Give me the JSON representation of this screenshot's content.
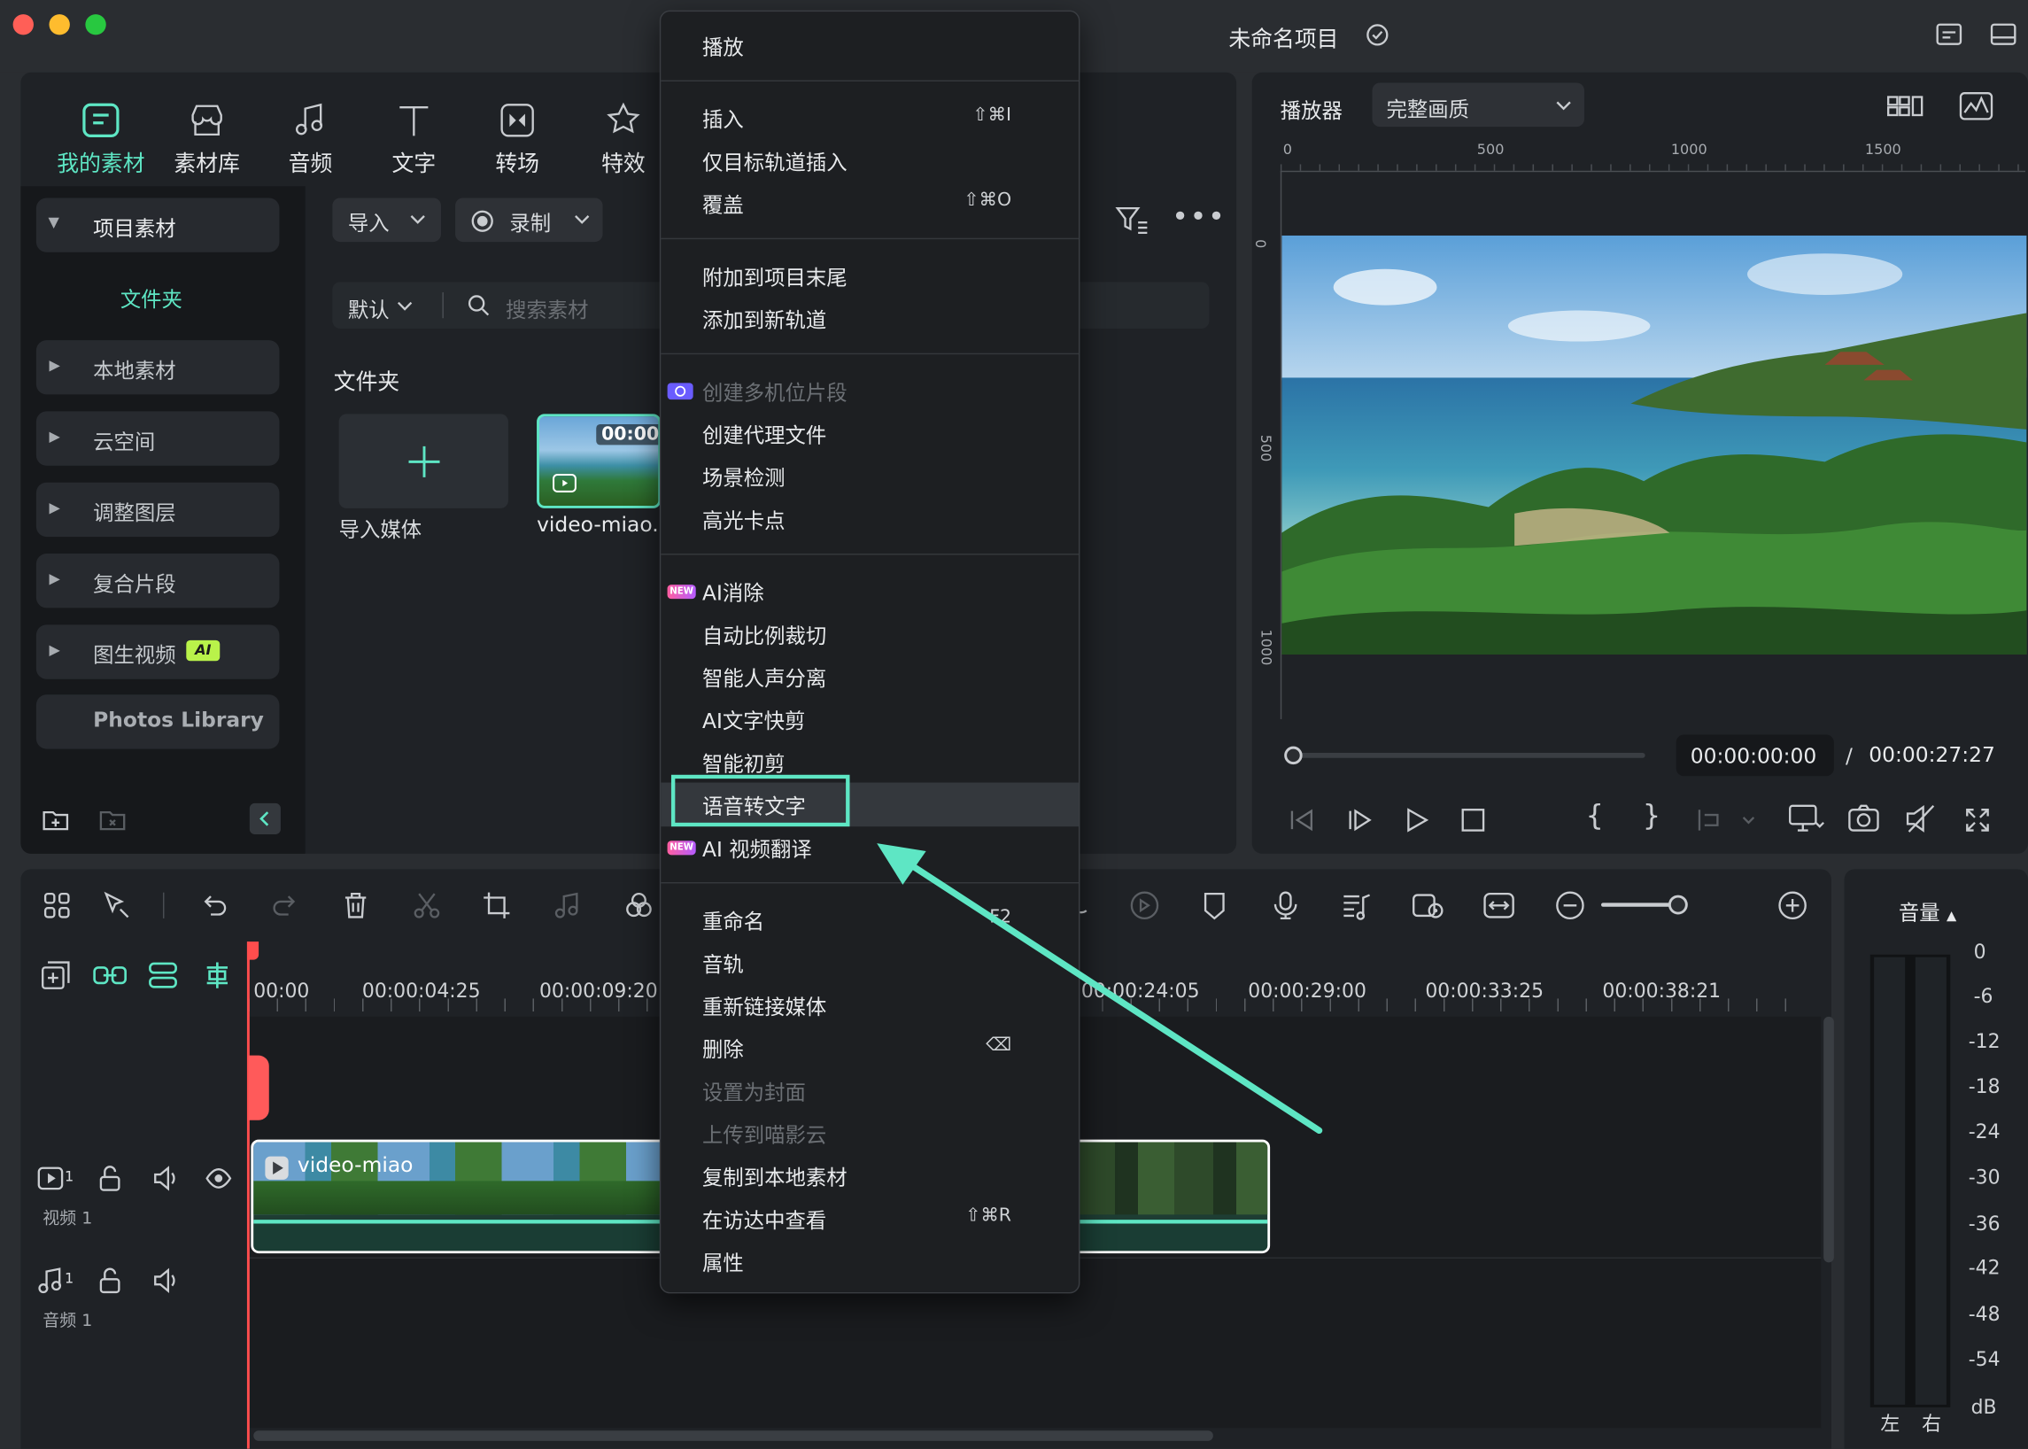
{
  "window": {
    "title": "未命名项目"
  },
  "tabs": [
    {
      "label": "我的素材",
      "icon": "my-media-icon",
      "active": true
    },
    {
      "label": "素材库",
      "icon": "stock-icon"
    },
    {
      "label": "音频",
      "icon": "music-icon"
    },
    {
      "label": "文字",
      "icon": "text-icon"
    },
    {
      "label": "转场",
      "icon": "transition-icon"
    },
    {
      "label": "特效",
      "icon": "effects-icon"
    }
  ],
  "sidebar": {
    "project_media": "项目素材",
    "folder": "文件夹",
    "items": [
      "本地素材",
      "云空间",
      "调整图层",
      "复合片段",
      "图生视频"
    ],
    "ai_badge": "AI",
    "photos": "Photos Library"
  },
  "media": {
    "import_label": "导入",
    "record_label": "录制",
    "sort_label": "默认",
    "search_placeholder": "搜索素材",
    "folder_title": "文件夹",
    "import_media_label": "导入媒体",
    "clip_name": "video-miao.",
    "clip_duration": "00:00"
  },
  "player": {
    "label": "播放器",
    "quality": "完整画质",
    "ruler_h": [
      "0",
      "500",
      "1000",
      "1500"
    ],
    "ruler_v": [
      "0",
      "500",
      "1000"
    ],
    "current_time": "00:00:00:00",
    "separator": "/",
    "total_time": "00:00:27:27",
    "progress": 0
  },
  "context_menu": {
    "groups": [
      [
        {
          "label": "播放"
        }
      ],
      [
        {
          "label": "插入",
          "shortcut": "⇧⌘I"
        },
        {
          "label": "仅目标轨道插入"
        },
        {
          "label": "覆盖",
          "shortcut": "⇧⌘O"
        }
      ],
      [
        {
          "label": "附加到项目末尾"
        },
        {
          "label": "添加到新轨道"
        }
      ],
      [
        {
          "label": "创建多机位片段",
          "disabled": true
        },
        {
          "label": "创建代理文件"
        },
        {
          "label": "场景检测"
        },
        {
          "label": "高光卡点"
        }
      ],
      [
        {
          "label": "AI消除",
          "badge": "NEW"
        },
        {
          "label": "自动比例裁切"
        },
        {
          "label": "智能人声分离"
        },
        {
          "label": "AI文字快剪"
        },
        {
          "label": "智能初剪"
        },
        {
          "label": "语音转文字",
          "highlighted": true
        },
        {
          "label": "AI 视频翻译",
          "badge": "NEW"
        }
      ],
      [
        {
          "label": "重命名",
          "shortcut": "F2"
        },
        {
          "label": "音轨"
        },
        {
          "label": "重新链接媒体"
        },
        {
          "label": "删除",
          "shortcut": "⌫"
        },
        {
          "label": "设置为封面",
          "disabled": true
        },
        {
          "label": "上传到喵影云",
          "disabled": true
        },
        {
          "label": "复制到本地素材"
        },
        {
          "label": "在访达中查看",
          "shortcut": "⇧⌘R"
        },
        {
          "label": "属性"
        }
      ]
    ]
  },
  "timeline": {
    "timecodes": [
      "00:00",
      "00:00:04:25",
      "00:00:09:20",
      "00:00:24:05",
      "00:00:29:00",
      "00:00:33:25",
      "00:00:38:21"
    ],
    "video_track": {
      "num": "1",
      "label": "视频 1"
    },
    "audio_track": {
      "num": "1",
      "label": "音频 1"
    },
    "clip_name": "video-miao"
  },
  "audio_meter": {
    "label": "音量",
    "scale": [
      "0",
      "-6",
      "-12",
      "-18",
      "-24",
      "-30",
      "-36",
      "-42",
      "-48",
      "-54",
      "dB"
    ],
    "left": "左",
    "right": "右"
  },
  "colors": {
    "accent": "#5ee6c4",
    "background": "#2a2d31",
    "panel": "#1f2226",
    "playhead": "#ff4d4d"
  }
}
